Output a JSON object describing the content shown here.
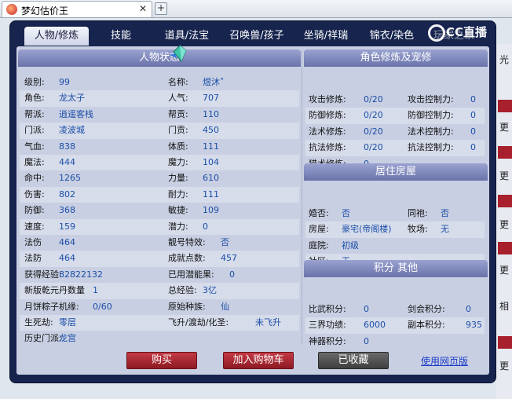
{
  "browser": {
    "tab_title": "梦幻估价王",
    "close_glyph": "✕",
    "newtab_glyph": "+"
  },
  "nav": {
    "tabs": [
      "人物/修炼",
      "技能",
      "道具/法宝",
      "召唤兽/孩子",
      "坐骑/祥瑞",
      "锦衣/染色",
      "玩家之家"
    ],
    "active": 0,
    "logo_text": "CC直播"
  },
  "char_panel": {
    "title": "人物状态",
    "rows": [
      [
        {
          "l": "级别:",
          "v": "99"
        },
        {
          "l": "名称:",
          "v": "煜沐˚"
        }
      ],
      [
        {
          "l": "角色:",
          "v": "龙太子"
        },
        {
          "l": "人气:",
          "v": "707"
        }
      ],
      [
        {
          "l": "帮派:",
          "v": "逍遥客栈"
        },
        {
          "l": "帮贡:",
          "v": "110"
        }
      ],
      [
        {
          "l": "门派:",
          "v": "凌波城"
        },
        {
          "l": "门贡:",
          "v": "450"
        }
      ],
      [
        {
          "l": "气血:",
          "v": "838"
        },
        {
          "l": "体质:",
          "v": "111"
        }
      ],
      [
        {
          "l": "魔法:",
          "v": "444"
        },
        {
          "l": "魔力:",
          "v": "104"
        }
      ],
      [
        {
          "l": "命中:",
          "v": "1265"
        },
        {
          "l": "力量:",
          "v": "610"
        }
      ],
      [
        {
          "l": "伤害:",
          "v": "802"
        },
        {
          "l": "耐力:",
          "v": "111"
        }
      ],
      [
        {
          "l": "防御:",
          "v": "368"
        },
        {
          "l": "敏捷:",
          "v": "109"
        }
      ],
      [
        {
          "l": "速度:",
          "v": "159"
        },
        {
          "l": "潜力:",
          "v": "0"
        }
      ],
      [
        {
          "l": "法伤",
          "v": "464"
        },
        {
          "l": "靓号特效:",
          "v": "否"
        }
      ],
      [
        {
          "l": "法防",
          "v": "464"
        },
        {
          "l": "成就点数:",
          "v": "457"
        }
      ],
      [
        {
          "l": "获得经验:",
          "v": "82822132"
        },
        {
          "l": "已用潜能果:",
          "v": "0"
        }
      ],
      [
        {
          "l": "新版乾元丹数量",
          "v": "1"
        },
        {
          "l": "总经验:",
          "v": "3亿"
        }
      ],
      [
        {
          "l": "月饼粽子机缘:",
          "v": "0/60"
        },
        {
          "l": "原始种族:",
          "v": "仙"
        }
      ],
      [
        {
          "l": "生死劫:",
          "v": "零层"
        },
        {
          "l": "飞升/渡劫/化圣:",
          "v": "未飞升"
        }
      ],
      [
        {
          "l": "历史门派:",
          "v": "龙宫"
        },
        {
          "l": "",
          "v": ""
        }
      ]
    ]
  },
  "cultivation_panel": {
    "title": "角色修炼及宠修",
    "rows": [
      [
        {
          "l": "攻击修炼:",
          "v": "0/20"
        },
        {
          "l": "攻击控制力:",
          "v": "0"
        }
      ],
      [
        {
          "l": "防御修炼:",
          "v": "0/20"
        },
        {
          "l": "防御控制力:",
          "v": "0"
        }
      ],
      [
        {
          "l": "法术修炼:",
          "v": "0/20"
        },
        {
          "l": "法术控制力:",
          "v": "0"
        }
      ],
      [
        {
          "l": "抗法修炼:",
          "v": "0/20"
        },
        {
          "l": "抗法控制力:",
          "v": "0"
        }
      ],
      [
        {
          "l": "猎术修炼:",
          "v": "0"
        },
        {
          "l": "",
          "v": ""
        }
      ]
    ]
  },
  "house_panel": {
    "title": "居住房屋",
    "rows": [
      [
        {
          "l": "婚否:",
          "v": "否"
        },
        {
          "l": "同袍:",
          "v": "否"
        }
      ],
      [
        {
          "l": "房屋:",
          "v": "豪宅(帝阁楼)"
        },
        {
          "l": "牧场:",
          "v": "无"
        }
      ],
      [
        {
          "l": "庭院:",
          "v": "初级"
        },
        {
          "l": "",
          "v": ""
        }
      ],
      [
        {
          "l": "社区:",
          "v": "无"
        },
        {
          "l": "",
          "v": ""
        }
      ]
    ]
  },
  "score_panel": {
    "title": "积分 其他",
    "rows": [
      [
        {
          "l": "比武积分:",
          "v": "0"
        },
        {
          "l": "剑会积分:",
          "v": "0"
        }
      ],
      [
        {
          "l": "三界功绩:",
          "v": "6000"
        },
        {
          "l": "副本积分:",
          "v": "935"
        }
      ],
      [
        {
          "l": "神器积分:",
          "v": "0"
        },
        {
          "l": "",
          "v": ""
        }
      ]
    ]
  },
  "buttons": {
    "buy": "购买",
    "add_cart": "加入购物车",
    "collected": "已收藏",
    "web_version": "使用网页版"
  },
  "bg_edge": [
    "光",
    "更",
    "更",
    "更",
    "更",
    "相",
    "更"
  ]
}
